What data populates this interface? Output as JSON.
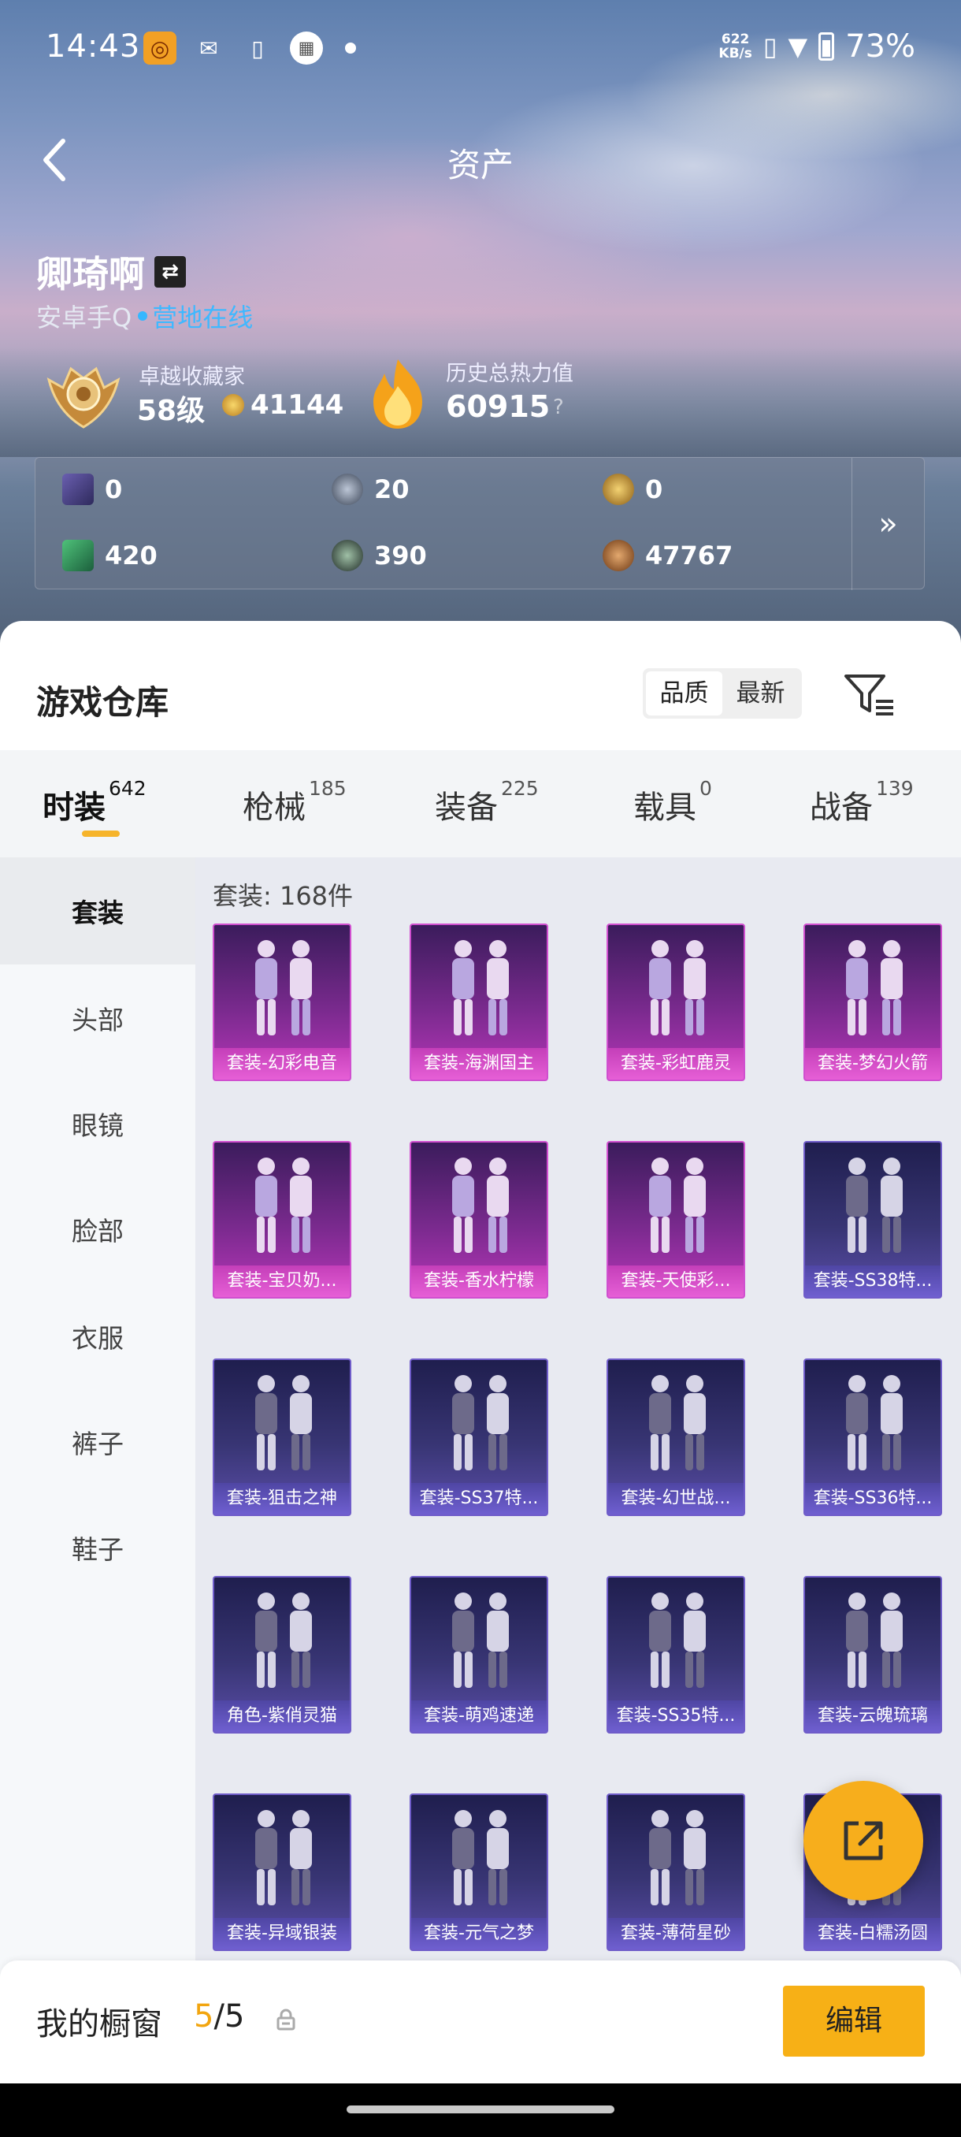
{
  "status_bar": {
    "time": "14:43",
    "net_speed_value": "622",
    "net_speed_unit": "KB/s",
    "battery": "73%"
  },
  "header": {
    "title": "资产"
  },
  "profile": {
    "name": "卿琦啊",
    "platform": "安卓手Q",
    "online_status": "营地在线",
    "collector_label": "卓越收藏家",
    "collector_level": "58级",
    "collector_points": "41144",
    "heat_label": "历史总热力值",
    "heat_value": "60915",
    "heat_help": "?"
  },
  "currencies": [
    {
      "icon": "card-ticket-icon",
      "value": "0"
    },
    {
      "icon": "silver-coin-icon",
      "value": "20"
    },
    {
      "icon": "gold-token-icon",
      "value": "0"
    },
    {
      "icon": "green-ticket-icon",
      "value": "420"
    },
    {
      "icon": "dark-orb-icon",
      "value": "390"
    },
    {
      "icon": "bronze-coin-icon",
      "value": "47767"
    }
  ],
  "warehouse": {
    "title": "游戏仓库",
    "sort_options": [
      "品质",
      "最新"
    ],
    "active_sort": "品质"
  },
  "category_tabs": [
    {
      "label": "时装",
      "count": "642"
    },
    {
      "label": "枪械",
      "count": "185"
    },
    {
      "label": "装备",
      "count": "225"
    },
    {
      "label": "载具",
      "count": "0"
    },
    {
      "label": "战备",
      "count": "139"
    }
  ],
  "side_nav": [
    "套装",
    "头部",
    "眼镜",
    "脸部",
    "衣服",
    "裤子",
    "鞋子"
  ],
  "grid": {
    "count_label": "套装: 168件",
    "items": [
      {
        "label": "套装-幻彩电音",
        "tier": "pink"
      },
      {
        "label": "套装-海渊国主",
        "tier": "pink"
      },
      {
        "label": "套装-彩虹鹿灵",
        "tier": "pink"
      },
      {
        "label": "套装-梦幻火箭",
        "tier": "pink"
      },
      {
        "label": "套装-宝贝奶...",
        "tier": "pink"
      },
      {
        "label": "套装-香水柠檬",
        "tier": "pink"
      },
      {
        "label": "套装-天使彩...",
        "tier": "pink"
      },
      {
        "label": "套装-SS38特...",
        "tier": "purple"
      },
      {
        "label": "套装-狙击之神",
        "tier": "purple"
      },
      {
        "label": "套装-SS37特...",
        "tier": "purple"
      },
      {
        "label": "套装-幻世战...",
        "tier": "purple"
      },
      {
        "label": "套装-SS36特...",
        "tier": "purple"
      },
      {
        "label": "角色-紫俏灵猫",
        "tier": "purple"
      },
      {
        "label": "套装-萌鸡速递",
        "tier": "purple"
      },
      {
        "label": "套装-SS35特...",
        "tier": "purple"
      },
      {
        "label": "套装-云魄琉璃",
        "tier": "purple"
      },
      {
        "label": "套装-异域银装",
        "tier": "purple"
      },
      {
        "label": "套装-元气之梦",
        "tier": "purple"
      },
      {
        "label": "套装-薄荷星砂",
        "tier": "purple"
      },
      {
        "label": "套装-白糯汤圆",
        "tier": "purple"
      }
    ]
  },
  "showcase": {
    "title": "我的橱窗",
    "count_current": "5",
    "count_sep": "/",
    "count_total": "5",
    "edit_label": "编辑"
  },
  "colors": {
    "accent": "#f7b016",
    "online": "#3fb8ff",
    "pink_tier": "#d04fcf",
    "purple_tier": "#6f5cc9"
  }
}
